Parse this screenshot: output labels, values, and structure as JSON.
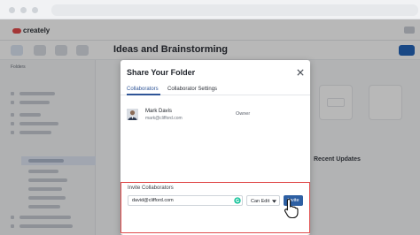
{
  "app": {
    "logo_text": "creately",
    "page_title": "Ideas and Brainstorming",
    "sidebar_heading": "Folders",
    "right_section_title": "Recent Updates"
  },
  "modal": {
    "title": "Share Your Folder",
    "tabs": [
      {
        "label": "Collaborators",
        "active": true
      },
      {
        "label": "Collaborator Settings",
        "active": false
      }
    ],
    "collaborators": [
      {
        "name": "Mark Davis",
        "email": "mark@clifford.com",
        "role": "Owner"
      }
    ],
    "invite": {
      "label": "Invite Collaborators",
      "email_value": "david@clifford.com",
      "permission": "Can Edit",
      "button_label": "Invite"
    }
  },
  "icons": {
    "close": "close-icon",
    "caret": "chevron-down-icon",
    "grammar": "grammarly-icon",
    "cursor": "hand-pointer-icon"
  },
  "colors": {
    "accent": "#2d5fa3",
    "highlight_border": "#e04a4a"
  }
}
